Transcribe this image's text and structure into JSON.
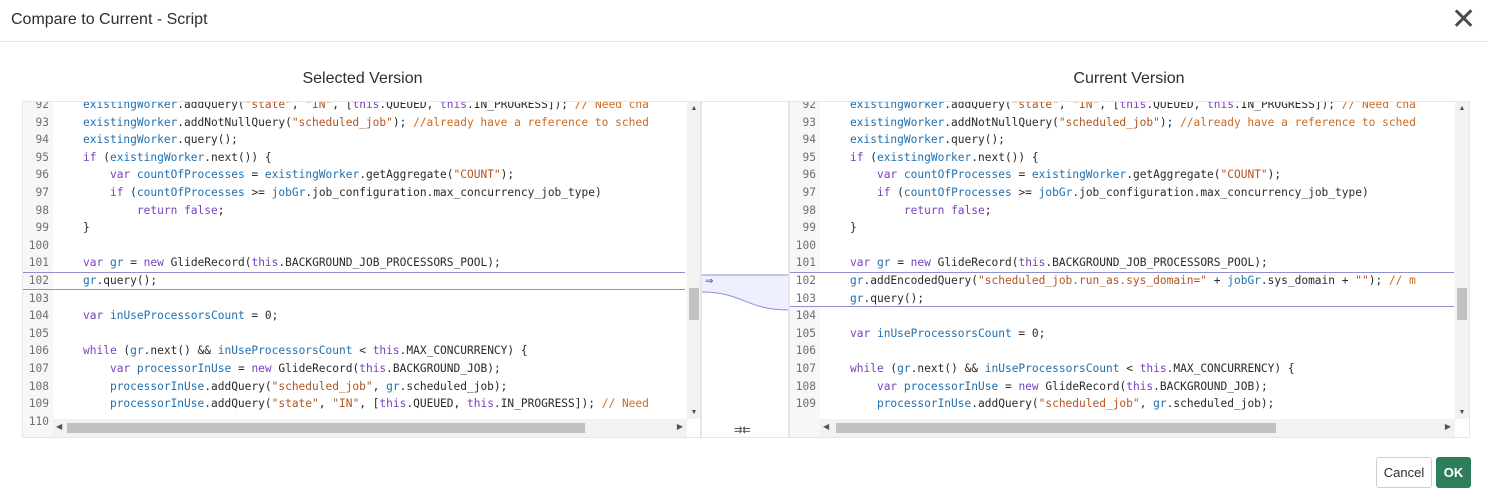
{
  "dialog": {
    "title": "Compare to Current - Script",
    "close_glyph": "✕"
  },
  "left": {
    "heading": "Selected Version",
    "highlighted_line": "102",
    "lines": [
      {
        "n": "92",
        "t": "existingWorker.addQuery(\"state\", \"IN\", [this.QUEUED, this.IN_PROGRESS]); // Need cha"
      },
      {
        "n": "93",
        "t": "existingWorker.addNotNullQuery(\"scheduled_job\"); //already have a reference to sched"
      },
      {
        "n": "94",
        "t": "existingWorker.query();"
      },
      {
        "n": "95",
        "t": "if (existingWorker.next()) {"
      },
      {
        "n": "96",
        "t": "    var countOfProcesses = existingWorker.getAggregate(\"COUNT\");"
      },
      {
        "n": "97",
        "t": "    if (countOfProcesses >= jobGr.job_configuration.max_concurrency_job_type)"
      },
      {
        "n": "98",
        "t": "        return false;"
      },
      {
        "n": "99",
        "t": "}"
      },
      {
        "n": "100",
        "t": ""
      },
      {
        "n": "101",
        "t": "var gr = new GlideRecord(this.BACKGROUND_JOB_PROCESSORS_POOL);"
      },
      {
        "n": "102",
        "t": "gr.query();"
      },
      {
        "n": "103",
        "t": ""
      },
      {
        "n": "104",
        "t": "var inUseProcessorsCount = 0;"
      },
      {
        "n": "105",
        "t": ""
      },
      {
        "n": "106",
        "t": "while (gr.next() && inUseProcessorsCount < this.MAX_CONCURRENCY) {"
      },
      {
        "n": "107",
        "t": "    var processorInUse = new GlideRecord(this.BACKGROUND_JOB);"
      },
      {
        "n": "108",
        "t": "    processorInUse.addQuery(\"scheduled_job\", gr.scheduled_job);"
      },
      {
        "n": "109",
        "t": "    processorInUse.addQuery(\"state\", \"IN\", [this.QUEUED, this.IN_PROGRESS]); // Need"
      },
      {
        "n": "110",
        "t": ""
      }
    ]
  },
  "right": {
    "heading": "Current Version",
    "highlighted_lines": [
      "102",
      "103"
    ],
    "lines": [
      {
        "n": "92",
        "t": "existingWorker.addQuery(\"state\", \"IN\", [this.QUEUED, this.IN_PROGRESS]); // Need cha"
      },
      {
        "n": "93",
        "t": "existingWorker.addNotNullQuery(\"scheduled_job\"); //already have a reference to sched"
      },
      {
        "n": "94",
        "t": "existingWorker.query();"
      },
      {
        "n": "95",
        "t": "if (existingWorker.next()) {"
      },
      {
        "n": "96",
        "t": "    var countOfProcesses = existingWorker.getAggregate(\"COUNT\");"
      },
      {
        "n": "97",
        "t": "    if (countOfProcesses >= jobGr.job_configuration.max_concurrency_job_type)"
      },
      {
        "n": "98",
        "t": "        return false;"
      },
      {
        "n": "99",
        "t": "}"
      },
      {
        "n": "100",
        "t": ""
      },
      {
        "n": "101",
        "t": "var gr = new GlideRecord(this.BACKGROUND_JOB_PROCESSORS_POOL);"
      },
      {
        "n": "102",
        "t": "gr.addEncodedQuery(\"scheduled_job.run_as.sys_domain=\" + jobGr.sys_domain + \"\"); // m"
      },
      {
        "n": "103",
        "t": "gr.query();"
      },
      {
        "n": "104",
        "t": ""
      },
      {
        "n": "105",
        "t": "var inUseProcessorsCount = 0;"
      },
      {
        "n": "106",
        "t": ""
      },
      {
        "n": "107",
        "t": "while (gr.next() && inUseProcessorsCount < this.MAX_CONCURRENCY) {"
      },
      {
        "n": "108",
        "t": "    var processorInUse = new GlideRecord(this.BACKGROUND_JOB);"
      },
      {
        "n": "109",
        "t": "    processorInUse.addQuery(\"scheduled_job\", gr.scheduled_job);"
      }
    ]
  },
  "merge_gutter": {
    "copy_arrow": "⇒",
    "sync_icon": "⇉⇇"
  },
  "footer": {
    "cancel_label": "Cancel",
    "ok_label": "OK"
  },
  "colors": {
    "ok_button": "#2e7d5b",
    "diff_highlight": "#8f8fd0",
    "keyword": "#7a3fbf",
    "string": "#b3541e",
    "identifier": "#1f6fb0"
  }
}
